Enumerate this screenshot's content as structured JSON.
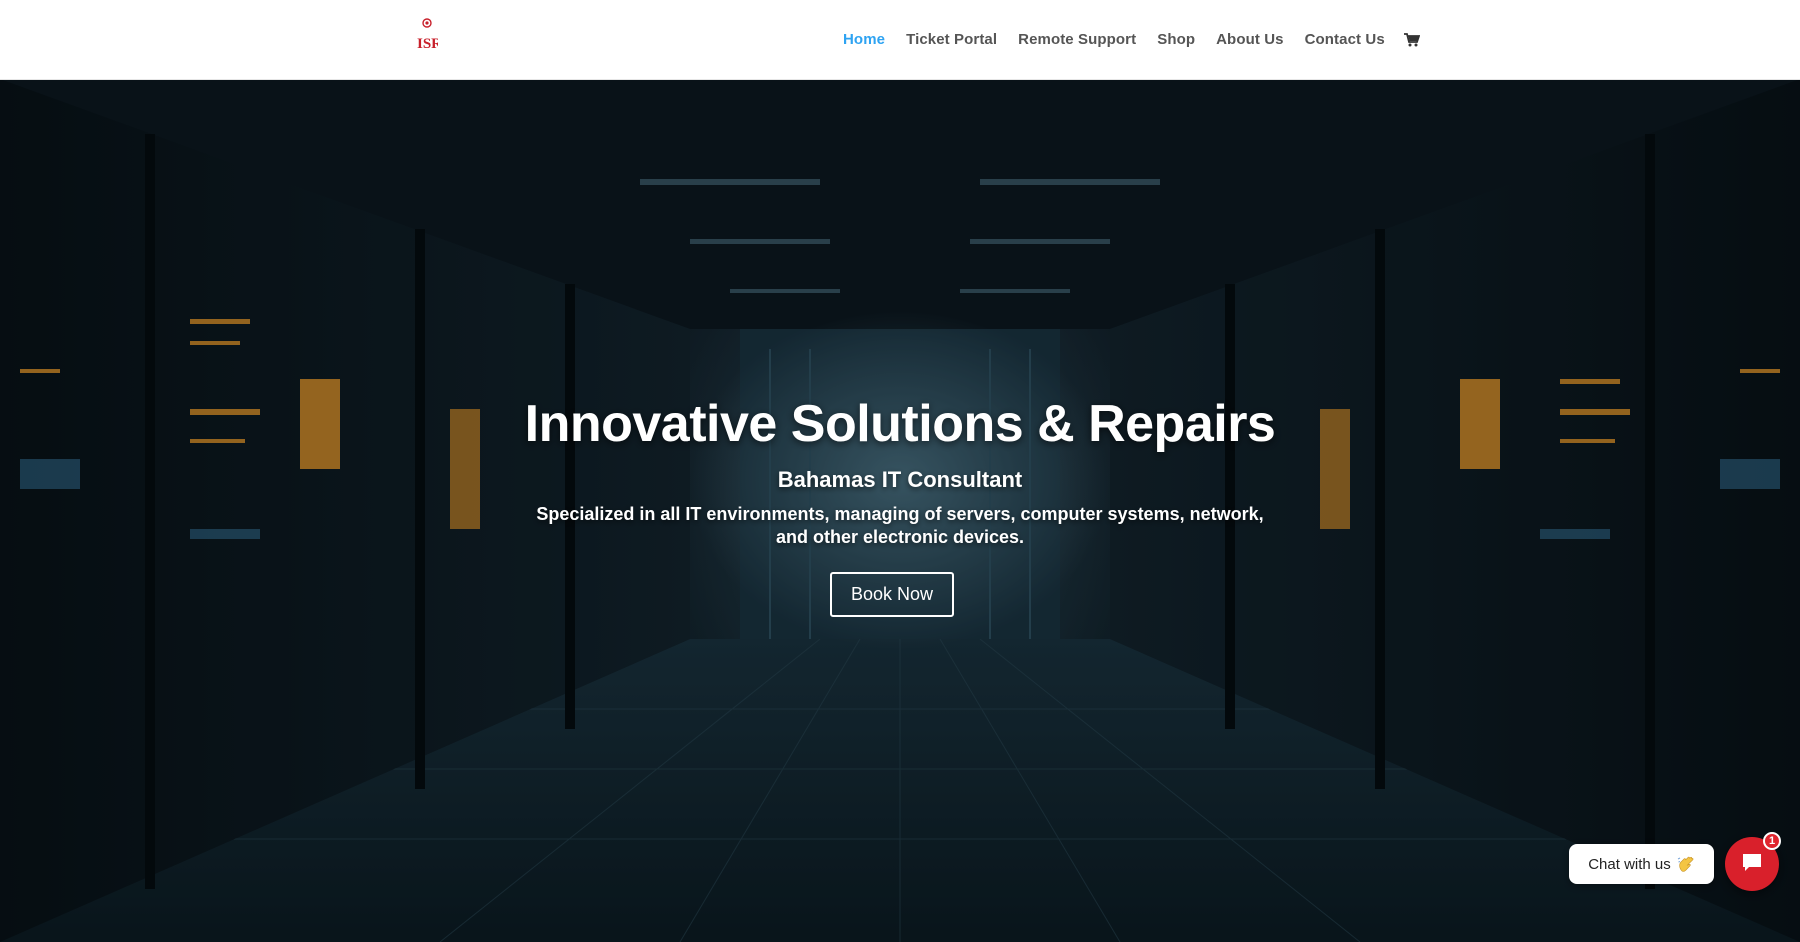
{
  "header": {
    "logo_text": "ISR",
    "nav": [
      {
        "label": "Home",
        "active": true
      },
      {
        "label": "Ticket Portal",
        "active": false
      },
      {
        "label": "Remote Support",
        "active": false
      },
      {
        "label": "Shop",
        "active": false
      },
      {
        "label": "About Us",
        "active": false
      },
      {
        "label": "Contact Us",
        "active": false
      }
    ],
    "cart_icon": "shopping-cart-icon"
  },
  "hero": {
    "title": "Innovative Solutions & Repairs",
    "subtitle": "Bahamas IT Consultant",
    "description": "Specialized in all IT environments, managing of servers, computer systems, network, and other electronic devices.",
    "button_label": "Book Now"
  },
  "chat": {
    "label": "Chat with us",
    "wave_icon": "waving-hand-icon",
    "button_icon": "chat-bubble-icon",
    "badge_count": "1"
  },
  "colors": {
    "nav_active": "#2ea3f2",
    "nav_text": "#555555",
    "chat_red": "#d9202b",
    "logo_red": "#c8202b"
  }
}
